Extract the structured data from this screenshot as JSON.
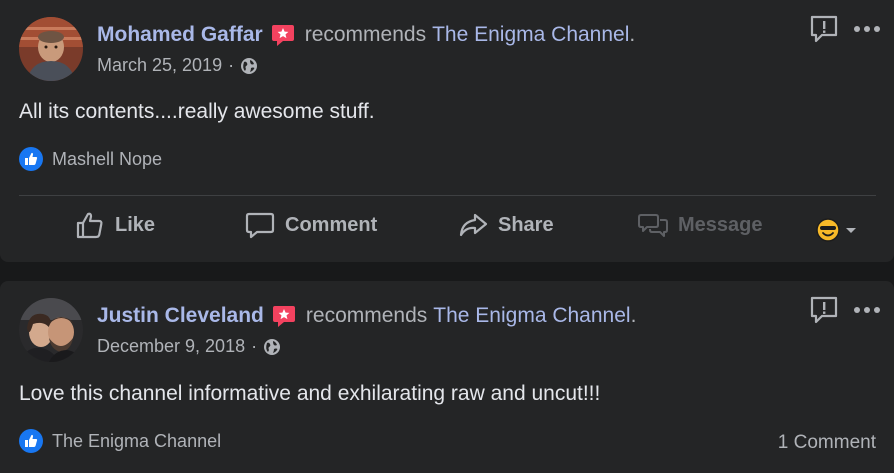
{
  "posts": [
    {
      "author": "Mohamed Gaffar",
      "verb": "recommends",
      "page": "The Enigma Channel",
      "period": ".",
      "date": "March 25, 2019",
      "separator": "·",
      "text": "All its contents....really awesome stuff.",
      "reaction_by": "Mashell Nope",
      "actions": {
        "like": "Like",
        "comment": "Comment",
        "share": "Share",
        "message": "Message"
      }
    },
    {
      "author": "Justin Cleveland",
      "verb": "recommends",
      "page": "The Enigma Channel",
      "period": ".",
      "date": "December 9, 2018",
      "separator": "·",
      "text": "Love this channel informative and exhilarating raw and uncut!!!",
      "reaction_by": "The Enigma Channel",
      "comment_count": "1 Comment"
    }
  ],
  "icons": {
    "badge": "recommendation-star-icon",
    "audience": "globe-icon",
    "report": "report-icon",
    "more": "more-options-icon",
    "reaction": "like-reaction-icon",
    "reaction_picker": "emoji-reaction-icon"
  },
  "colors": {
    "background": "#18191a",
    "card": "#242526",
    "link": "#a9b8e8",
    "secondary_text": "#b0b3b8",
    "badge": "#f3425f",
    "like_blue": "#1877f2"
  }
}
